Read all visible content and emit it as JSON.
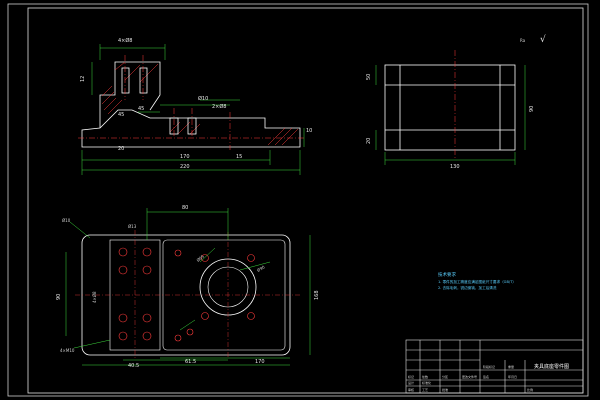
{
  "drawing": {
    "title_block_name": "夹具底座零件图",
    "check_mark": "√",
    "roughness_symbol": "Ra",
    "tech_requirements": {
      "heading": "技术要求",
      "items": [
        "1. 零件的加工精度应满足图纸尺寸要求（GB/T）",
        "2. 去除毛刺，锐边倒钝，加工后清洗"
      ]
    },
    "front_view": {
      "dims": [
        "4×Ø8",
        "12",
        "45",
        "Ø10",
        "2×Ø8",
        "170",
        "220",
        "20",
        "15",
        "10",
        "45"
      ]
    },
    "side_view": {
      "dims": [
        "50",
        "20",
        "90",
        "130"
      ]
    },
    "top_view": {
      "dims": [
        "80",
        "Ø13",
        "Ø10",
        "Ø65",
        "Ø90",
        "90",
        "168",
        "61.5",
        "170",
        "4×Ø8",
        "40.5",
        "4×M10"
      ]
    },
    "title_block_cells": [
      "标记",
      "处数",
      "分区",
      "更改文件号",
      "签名",
      "年月日",
      "设计",
      "标准化",
      "审核",
      "工艺",
      "批准",
      "阶段标记",
      "重量",
      "比例"
    ]
  }
}
